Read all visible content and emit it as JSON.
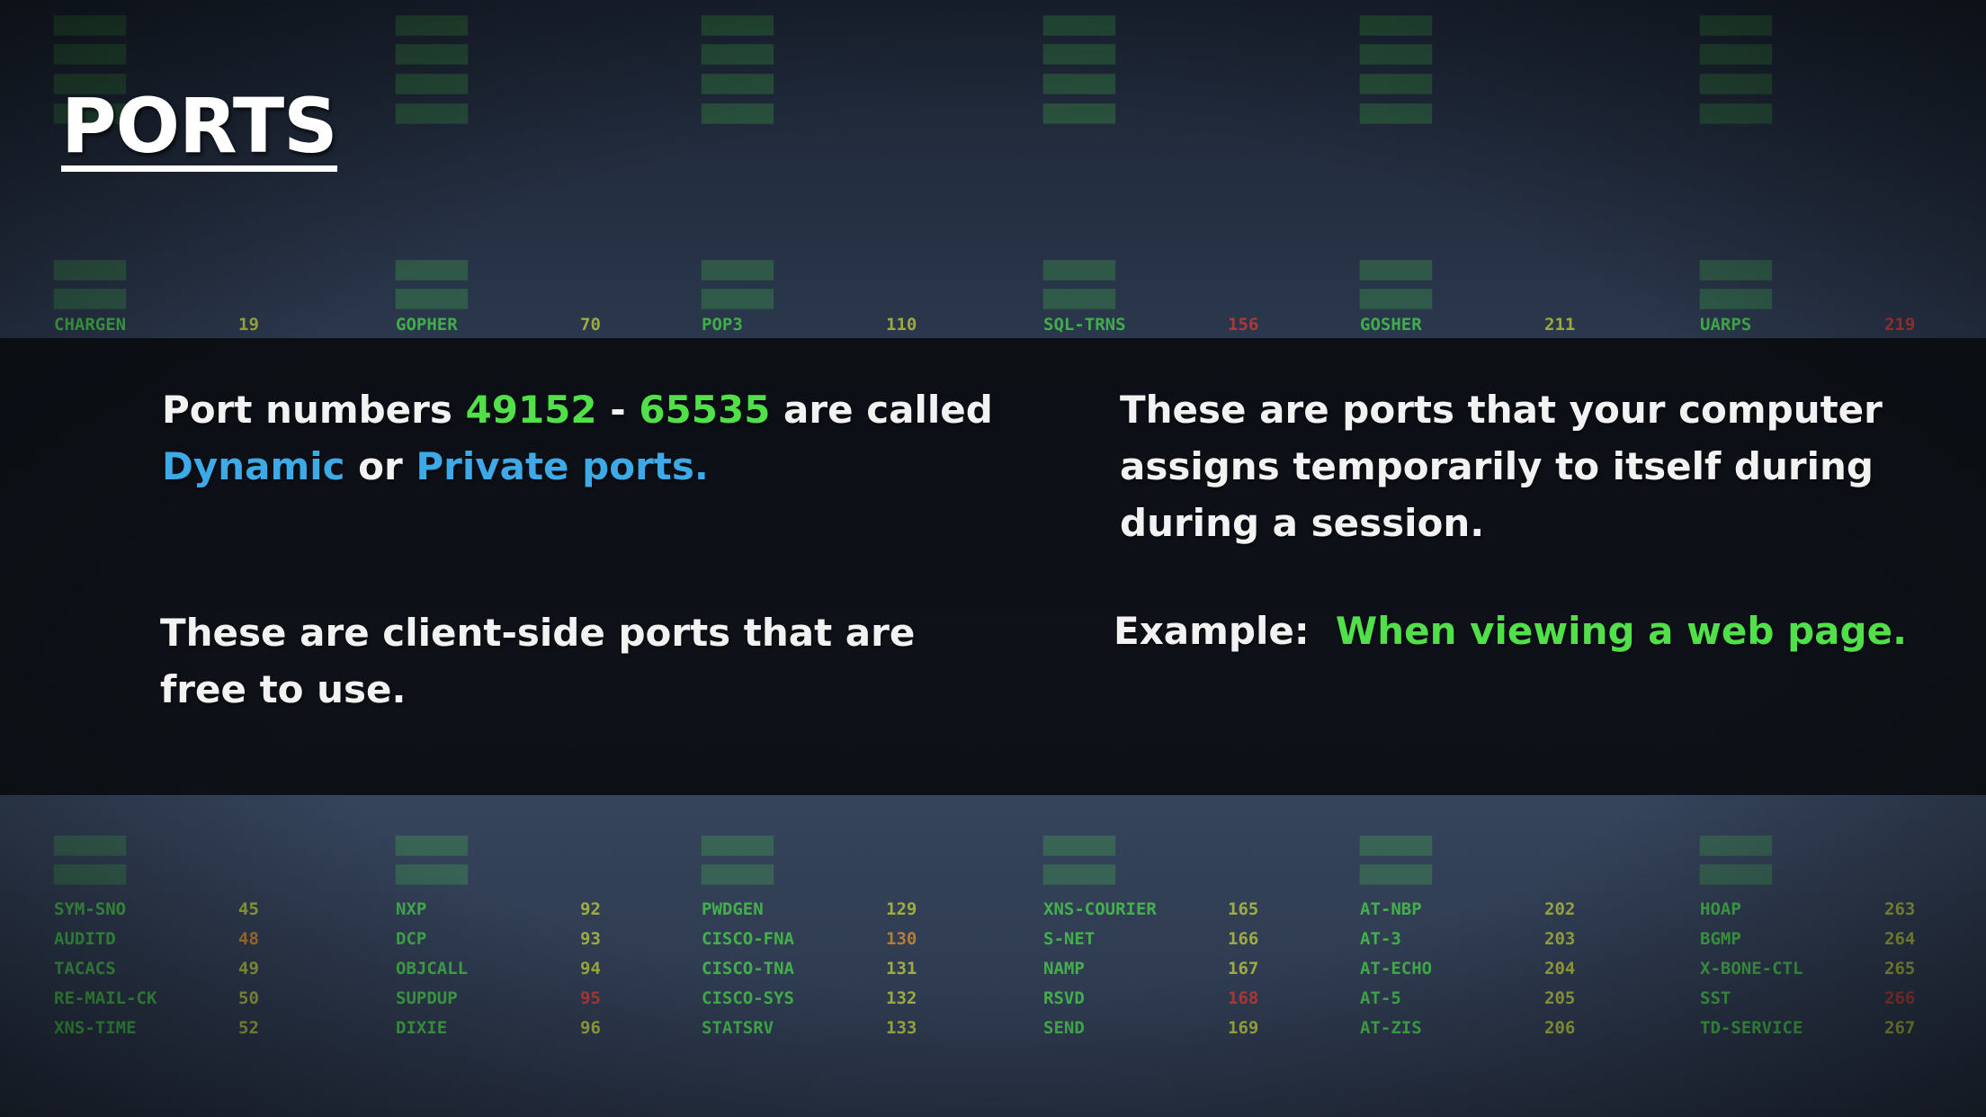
{
  "title": "PORTS",
  "statements": {
    "left_top": {
      "prefix": "Port numbers ",
      "range_start": "49152",
      "dash": " - ",
      "range_end": "65535",
      "middle": " are called",
      "dynamic": "Dynamic",
      "or": " or ",
      "private": "Private ports."
    },
    "right_top": "These are ports that your computer assigns temporarily to itself during during a session.",
    "left_bottom": "These are client-side ports that are free to use.",
    "right_bottom": {
      "label": "Example:",
      "value": "When viewing a web page."
    }
  },
  "background_table": [
    {
      "rows": [
        {
          "svc": "CHARGEN",
          "num": "19"
        },
        {
          "svc": "SYM-SNO",
          "num": "45"
        },
        {
          "svc": "AUDITD",
          "num": "48",
          "s": "o"
        },
        {
          "svc": "TACACS",
          "num": "49"
        },
        {
          "svc": "RE-MAIL-CK",
          "num": "50"
        },
        {
          "svc": "XNS-TIME",
          "num": "52"
        }
      ]
    },
    {
      "rows": [
        {
          "svc": "GOPHER",
          "num": "70"
        },
        {
          "svc": "NXP",
          "num": "92"
        },
        {
          "svc": "DCP",
          "num": "93"
        },
        {
          "svc": "OBJCALL",
          "num": "94"
        },
        {
          "svc": "SUPDUP",
          "num": "95",
          "s": "r"
        },
        {
          "svc": "DIXIE",
          "num": "96"
        }
      ]
    },
    {
      "rows": [
        {
          "svc": "POP3",
          "num": "110"
        },
        {
          "svc": "PWDGEN",
          "num": "129"
        },
        {
          "svc": "CISCO-FNA",
          "num": "130",
          "s": "o"
        },
        {
          "svc": "CISCO-TNA",
          "num": "131"
        },
        {
          "svc": "CISCO-SYS",
          "num": "132"
        },
        {
          "svc": "STATSRV",
          "num": "133"
        }
      ]
    },
    {
      "rows": [
        {
          "svc": "SQL-TRNS",
          "num": "156",
          "s": "r"
        },
        {
          "svc": "XNS-COURIER",
          "num": "165"
        },
        {
          "svc": "S-NET",
          "num": "166"
        },
        {
          "svc": "NAMP",
          "num": "167"
        },
        {
          "svc": "RSVD",
          "num": "168",
          "s": "r"
        },
        {
          "svc": "SEND",
          "num": "169"
        }
      ]
    },
    {
      "rows": [
        {
          "svc": "GOSHER",
          "num": "211"
        },
        {
          "svc": "AT-NBP",
          "num": "202"
        },
        {
          "svc": "AT-3",
          "num": "203"
        },
        {
          "svc": "AT-ECHO",
          "num": "204"
        },
        {
          "svc": "AT-5",
          "num": "205"
        },
        {
          "svc": "AT-ZIS",
          "num": "206"
        }
      ]
    },
    {
      "rows": [
        {
          "svc": "UARPS",
          "num": "219",
          "s": "r"
        },
        {
          "svc": "HOAP",
          "num": "263"
        },
        {
          "svc": "BGMP",
          "num": "264"
        },
        {
          "svc": "X-BONE-CTL",
          "num": "265"
        },
        {
          "svc": "SST",
          "num": "266",
          "s": "r"
        },
        {
          "svc": "TD-SERVICE",
          "num": "267"
        }
      ]
    }
  ],
  "colors": {
    "highlight_green": "#52e04a",
    "highlight_blue": "#3da9e6",
    "band": "#08090e",
    "text": "#f2f2f2"
  }
}
